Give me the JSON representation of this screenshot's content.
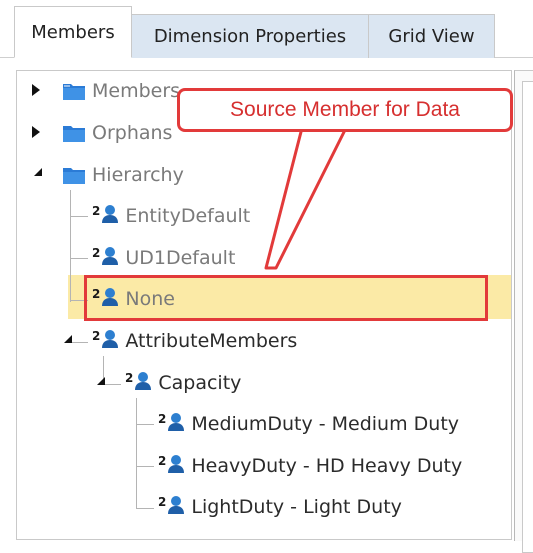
{
  "tabs": [
    {
      "label": "Members",
      "active": true
    },
    {
      "label": "Dimension Properties",
      "active": false
    },
    {
      "label": "Grid View",
      "active": false
    }
  ],
  "tree": {
    "members": {
      "label": "Members",
      "icon": "folder-icon"
    },
    "orphans": {
      "label": "Orphans",
      "icon": "folder-icon"
    },
    "hierarchy": {
      "label": "Hierarchy",
      "icon": "folder-icon"
    },
    "entity_default": {
      "label": "EntityDefault",
      "badge": "2",
      "icon": "user-icon"
    },
    "ud1_default": {
      "label": "UD1Default",
      "badge": "2",
      "icon": "user-icon"
    },
    "none": {
      "label": "None",
      "badge": "2",
      "icon": "user-icon"
    },
    "attribute_members": {
      "label": "AttributeMembers",
      "badge": "2",
      "icon": "user-icon"
    },
    "capacity": {
      "label": "Capacity",
      "badge": "2",
      "icon": "user-icon"
    },
    "medium_duty": {
      "label": "MediumDuty - Medium Duty",
      "badge": "2",
      "icon": "user-icon"
    },
    "heavy_duty": {
      "label": "HeavyDuty - HD Heavy Duty",
      "badge": "2",
      "icon": "user-icon"
    },
    "light_duty": {
      "label": "LightDuty - Light Duty",
      "badge": "2",
      "icon": "user-icon"
    }
  },
  "annotation": {
    "text": "Source Member for Data",
    "color": "#e23a3a"
  },
  "colors": {
    "highlight": "#fbeaa6",
    "folder": "#2b7bd6",
    "user_icon": "#2d7fd0",
    "tab_inactive": "#dbe6f2"
  }
}
